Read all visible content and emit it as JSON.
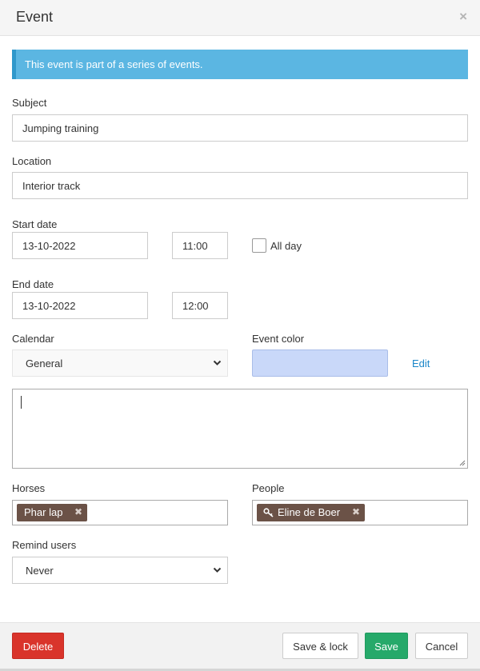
{
  "header": {
    "title": "Event",
    "close_symbol": "×"
  },
  "info_banner": "This event is part of a series of events.",
  "subject": {
    "label": "Subject",
    "value": "Jumping training"
  },
  "location": {
    "label": "Location",
    "value": "Interior track"
  },
  "start": {
    "label": "Start date",
    "date": "13-10-2022",
    "time": "11:00",
    "all_day_label": "All day",
    "all_day_checked": false
  },
  "end": {
    "label": "End date",
    "date": "13-10-2022",
    "time": "12:00"
  },
  "calendar": {
    "label": "Calendar",
    "selected": "General"
  },
  "event_color": {
    "label": "Event color",
    "color": "#c9d8f9",
    "edit_label": "Edit"
  },
  "description": {
    "value": ""
  },
  "horses": {
    "label": "Horses",
    "tags": [
      "Phar lap"
    ]
  },
  "people": {
    "label": "People",
    "tags": [
      "Eline de Boer"
    ]
  },
  "remind": {
    "label": "Remind users",
    "selected": "Never"
  },
  "footer": {
    "delete": "Delete",
    "save_lock": "Save & lock",
    "save": "Save",
    "cancel": "Cancel"
  },
  "colors": {
    "info": "#5bb6e2",
    "delete": "#d9342b",
    "save": "#26a96a",
    "tag": "#6b5247",
    "link": "#1a86c8"
  }
}
